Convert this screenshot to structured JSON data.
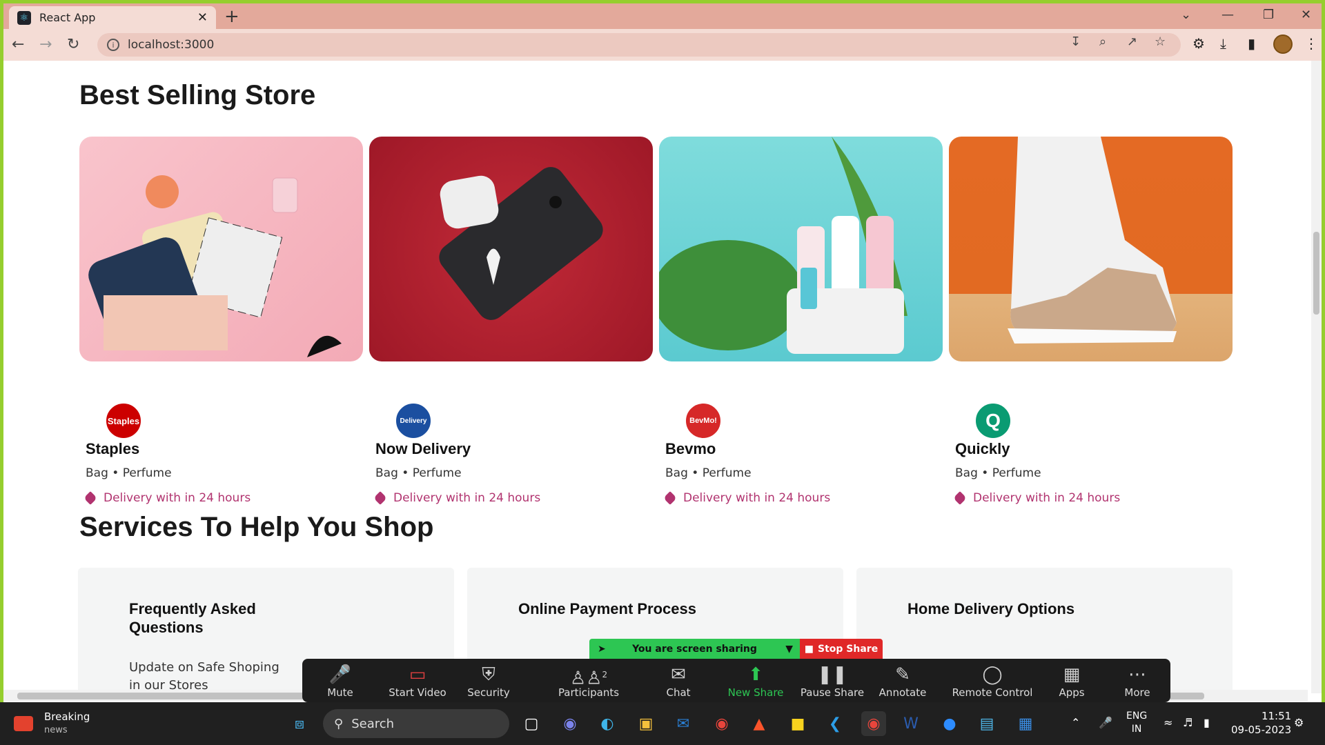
{
  "browser": {
    "tab_title": "React App",
    "url": "localhost:3000"
  },
  "best_selling": {
    "heading": "Best Selling Store",
    "stores": [
      {
        "name": "Staples",
        "logo_text": "Staples",
        "logo_color": "#cc0000",
        "categories": "Bag • Perfume",
        "delivery": "Delivery with in 24 hours"
      },
      {
        "name": "Now Delivery",
        "logo_text": "Delivery",
        "logo_color": "#1b4fa0",
        "categories": "Bag • Perfume",
        "delivery": "Delivery with in 24 hours"
      },
      {
        "name": "Bevmo",
        "logo_text": "BevMo!",
        "logo_color": "#d62828",
        "categories": "Bag • Perfume",
        "delivery": "Delivery with in 24 hours"
      },
      {
        "name": "Quickly",
        "logo_text": "Q",
        "logo_color": "#0a9b72",
        "categories": "Bag • Perfume",
        "delivery": "Delivery with in 24 hours"
      }
    ]
  },
  "services": {
    "heading": "Services To Help You Shop",
    "items": [
      {
        "title": "Frequently Asked Questions",
        "desc": "Update on Safe Shoping in our Stores"
      },
      {
        "title": "Online Payment Process",
        "desc": ""
      },
      {
        "title": "Home Delivery Options",
        "desc": ""
      }
    ]
  },
  "zoom": {
    "banner": "You are screen sharing",
    "stop": "Stop Share",
    "participants_count": "2",
    "controls": [
      "Mute",
      "Start Video",
      "Security",
      "Participants",
      "Chat",
      "New Share",
      "Pause Share",
      "Annotate",
      "Remote Control",
      "Apps",
      "More"
    ]
  },
  "taskbar": {
    "news_title": "Breaking",
    "news_sub": "news",
    "search": "Search",
    "lang1": "ENG",
    "lang2": "IN",
    "time": "11:51",
    "date": "09-05-2023"
  }
}
